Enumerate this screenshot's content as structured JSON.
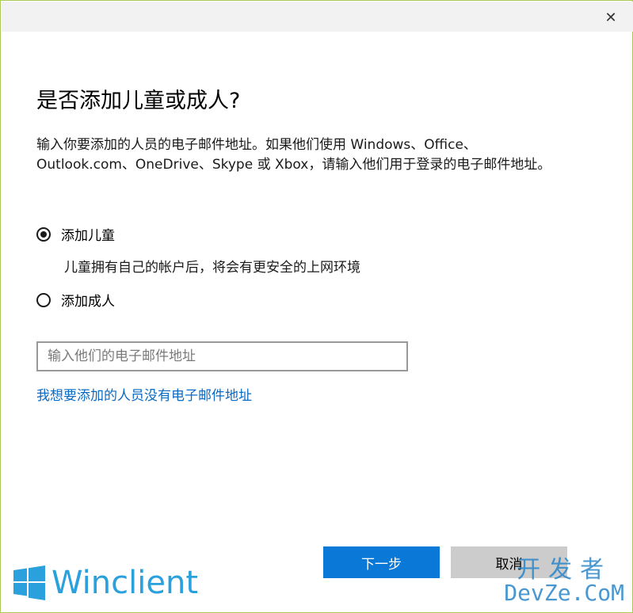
{
  "window": {
    "close_symbol": "✕"
  },
  "dialog": {
    "title": "是否添加儿童或成人?",
    "description": "输入你要添加的人员的电子邮件地址。如果他们使用 Windows、Office、Outlook.com、OneDrive、Skype 或 Xbox，请输入他们用于登录的电子邮件地址。",
    "options": [
      {
        "label": "添加儿童",
        "checked": true
      },
      {
        "label": "添加成人",
        "checked": false
      }
    ],
    "child_hint": "儿童拥有自己的帐户后，将会有更安全的上网环境",
    "email": {
      "value": "",
      "placeholder": "输入他们的电子邮件地址"
    },
    "no_email_link": "我想要添加的人员没有电子邮件地址",
    "buttons": {
      "next": "下一步",
      "cancel": "取消"
    }
  },
  "branding": {
    "name": "Winclient",
    "logo_icon": "windows-logo-icon"
  },
  "watermark": {
    "cn": "开发者",
    "en": "DevZe.CoM"
  },
  "colors": {
    "accent": "#0a78d7",
    "link": "#0a6ac4",
    "cancel_bg": "#cccccc",
    "brand": "#2aa0dd"
  }
}
